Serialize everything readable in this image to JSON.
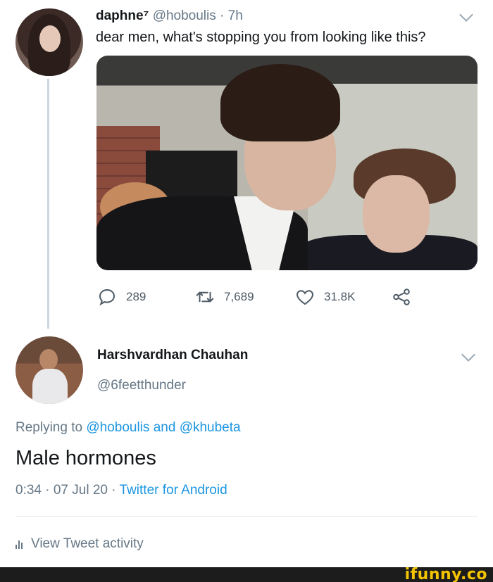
{
  "tweet": {
    "author_name": "daphne⁷",
    "author_handle": "@hoboulis",
    "separator": "·",
    "time": "7h",
    "text": "dear men, what's stopping you from looking like this?",
    "stats": {
      "replies": "289",
      "retweets": "7,689",
      "likes": "31.8K"
    }
  },
  "reply": {
    "author_name": "Harshvardhan Chauhan",
    "author_handle": "@6feetthunder",
    "replying_prefix": "Replying to",
    "replying_user1": "@hoboulis",
    "replying_and": "and",
    "replying_user2": "@khubeta",
    "text": "Male hormones",
    "timestamp": "0:34 · 07 Jul 20 ·",
    "client": "Twitter for Android",
    "activity_label": "View Tweet activity"
  },
  "watermark": "ifunny.co",
  "icons": {
    "reply": "reply-icon",
    "retweet": "retweet-icon",
    "like": "heart-icon",
    "share": "share-icon",
    "chevron": "chevron-down-icon",
    "activity": "bar-chart-icon"
  },
  "colors": {
    "link": "#1b95e0",
    "secondary_text": "#657786",
    "watermark": "#f4c400"
  }
}
